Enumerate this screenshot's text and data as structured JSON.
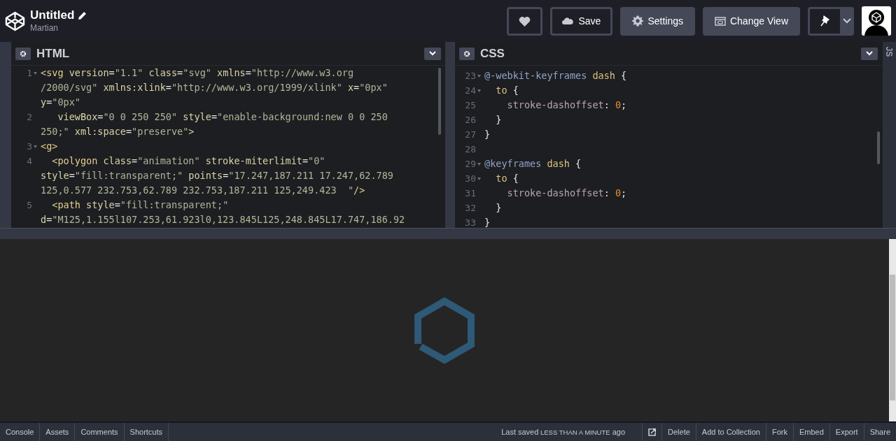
{
  "header": {
    "title": "Untitled",
    "author": "Martian",
    "buttons": [
      {
        "kind": "heart"
      },
      {
        "kind": "save",
        "label": "Save"
      },
      {
        "kind": "settings",
        "label": "Settings"
      },
      {
        "kind": "view",
        "label": "Change View"
      },
      {
        "kind": "pin"
      }
    ]
  },
  "editors": [
    {
      "title": "HTML",
      "rows": [
        {
          "number": "1",
          "foldable": true,
          "tokens": [
            {
              "kind": "tag",
              "text": "<svg"
            },
            {
              "kind": "attr",
              "text": " version"
            },
            {
              "kind": "punct",
              "text": "="
            },
            {
              "kind": "str",
              "text": "\"1.1\""
            },
            {
              "kind": "attr",
              "text": " class"
            },
            {
              "kind": "punct",
              "text": "="
            },
            {
              "kind": "str",
              "text": "\"svg\""
            },
            {
              "kind": "attr",
              "text": " xmlns"
            },
            {
              "kind": "punct",
              "text": "="
            },
            {
              "kind": "str",
              "text": "\"http://www.w3.org"
            }
          ]
        },
        {
          "tokens": [
            {
              "kind": "str",
              "text": "/2000/svg\""
            },
            {
              "kind": "attr",
              "text": " xmlns:xlink"
            },
            {
              "kind": "punct",
              "text": "="
            },
            {
              "kind": "str",
              "text": "\"http://www.w3.org/1999/xlink\""
            },
            {
              "kind": "attr",
              "text": " x"
            },
            {
              "kind": "punct",
              "text": "="
            },
            {
              "kind": "str",
              "text": "\"0px\""
            }
          ]
        },
        {
          "tokens": [
            {
              "kind": "attr",
              "text": "y"
            },
            {
              "kind": "punct",
              "text": "="
            },
            {
              "kind": "str",
              "text": "\"0px\""
            }
          ]
        },
        {
          "number": "2",
          "foldable": false,
          "tokens": [
            {
              "kind": "attr",
              "text": "   viewBox"
            },
            {
              "kind": "punct",
              "text": "="
            },
            {
              "kind": "str",
              "text": "\"0 0 250 250\""
            },
            {
              "kind": "attr",
              "text": " style"
            },
            {
              "kind": "punct",
              "text": "="
            },
            {
              "kind": "str",
              "text": "\"enable-background:new 0 0 250"
            }
          ]
        },
        {
          "tokens": [
            {
              "kind": "str",
              "text": "250;\""
            },
            {
              "kind": "attr",
              "text": " xml:space"
            },
            {
              "kind": "punct",
              "text": "="
            },
            {
              "kind": "str",
              "text": "\"preserve\""
            },
            {
              "kind": "tag",
              "text": ">"
            }
          ]
        },
        {
          "number": "3",
          "foldable": true,
          "tokens": [
            {
              "kind": "tag",
              "text": "<g>"
            }
          ]
        },
        {
          "number": "4",
          "foldable": false,
          "tokens": [
            {
              "kind": "tag",
              "text": "  <polygon"
            },
            {
              "kind": "attr",
              "text": " class"
            },
            {
              "kind": "punct",
              "text": "="
            },
            {
              "kind": "str",
              "text": "\"animation\""
            },
            {
              "kind": "attr",
              "text": " stroke-miterlimit"
            },
            {
              "kind": "punct",
              "text": "="
            },
            {
              "kind": "str",
              "text": "\"0\""
            }
          ]
        },
        {
          "tokens": [
            {
              "kind": "attr",
              "text": "style"
            },
            {
              "kind": "punct",
              "text": "="
            },
            {
              "kind": "str",
              "text": "\"fill:transparent;\""
            },
            {
              "kind": "attr",
              "text": " points"
            },
            {
              "kind": "punct",
              "text": "="
            },
            {
              "kind": "str",
              "text": "\"17.247,187.211 17.247,62.789"
            }
          ]
        },
        {
          "tokens": [
            {
              "kind": "str",
              "text": "125,0.577 232.753,62.789 232.753,187.211 125,249.423  \""
            },
            {
              "kind": "tag",
              "text": "/>"
            }
          ]
        },
        {
          "number": "5",
          "foldable": false,
          "tokens": [
            {
              "kind": "tag",
              "text": "  <path"
            },
            {
              "kind": "attr",
              "text": " style"
            },
            {
              "kind": "punct",
              "text": "="
            },
            {
              "kind": "str",
              "text": "\"fill:transparent;\""
            }
          ]
        },
        {
          "tokens": [
            {
              "kind": "attr",
              "text": "d"
            },
            {
              "kind": "punct",
              "text": "="
            },
            {
              "kind": "str",
              "text": "\"M125,1.155l107.253,61.923l0,123.845L125,248.845L17.747,186.92"
            }
          ]
        }
      ]
    },
    {
      "title": "CSS",
      "rows": [
        {
          "number": "23",
          "foldable": true,
          "tokens": [
            {
              "kind": "at",
              "text": "@-webkit-keyframes"
            },
            {
              "kind": "kw",
              "text": " dash"
            },
            {
              "kind": "punct",
              "text": " {"
            }
          ]
        },
        {
          "number": "24",
          "foldable": true,
          "tokens": [
            {
              "kind": "kw",
              "text": "  to"
            },
            {
              "kind": "punct",
              "text": " {"
            }
          ]
        },
        {
          "number": "25",
          "foldable": false,
          "tokens": [
            {
              "kind": "prop",
              "text": "    stroke-dashoffset"
            },
            {
              "kind": "punct",
              "text": ": "
            },
            {
              "kind": "num",
              "text": "0"
            },
            {
              "kind": "punct",
              "text": ";"
            }
          ]
        },
        {
          "number": "26",
          "foldable": false,
          "tokens": [
            {
              "kind": "punct",
              "text": "  }"
            }
          ]
        },
        {
          "number": "27",
          "foldable": false,
          "tokens": [
            {
              "kind": "punct",
              "text": "}"
            }
          ]
        },
        {
          "number": "28",
          "foldable": false,
          "tokens": []
        },
        {
          "number": "29",
          "foldable": true,
          "tokens": [
            {
              "kind": "at",
              "text": "@keyframes"
            },
            {
              "kind": "kw",
              "text": " dash"
            },
            {
              "kind": "punct",
              "text": " {"
            }
          ]
        },
        {
          "number": "30",
          "foldable": true,
          "tokens": [
            {
              "kind": "kw",
              "text": "  to"
            },
            {
              "kind": "punct",
              "text": " {"
            }
          ]
        },
        {
          "number": "31",
          "foldable": false,
          "tokens": [
            {
              "kind": "prop",
              "text": "    stroke-dashoffset"
            },
            {
              "kind": "punct",
              "text": ": "
            },
            {
              "kind": "num",
              "text": "0"
            },
            {
              "kind": "punct",
              "text": ";"
            }
          ]
        },
        {
          "number": "32",
          "foldable": false,
          "tokens": [
            {
              "kind": "punct",
              "text": "  }"
            }
          ]
        },
        {
          "number": "33",
          "foldable": false,
          "tokens": [
            {
              "kind": "punct",
              "text": "}"
            }
          ]
        }
      ]
    }
  ],
  "collapsed_editor": {
    "title": "JS"
  },
  "footer": {
    "tabs": [
      "Console",
      "Assets",
      "Comments",
      "Shortcuts"
    ],
    "last_saved": {
      "prefix": "Last saved",
      "time": "LESS THAN A MINUTE",
      "suffix": "ago"
    },
    "actions": [
      {
        "kind": "icon"
      },
      {
        "kind": "text",
        "label": "Delete"
      },
      {
        "kind": "text",
        "label": "Add to Collection"
      },
      {
        "kind": "text",
        "label": "Fork"
      },
      {
        "kind": "text",
        "label": "Embed"
      },
      {
        "kind": "text",
        "label": "Export"
      },
      {
        "kind": "text",
        "label": "Share"
      }
    ]
  }
}
